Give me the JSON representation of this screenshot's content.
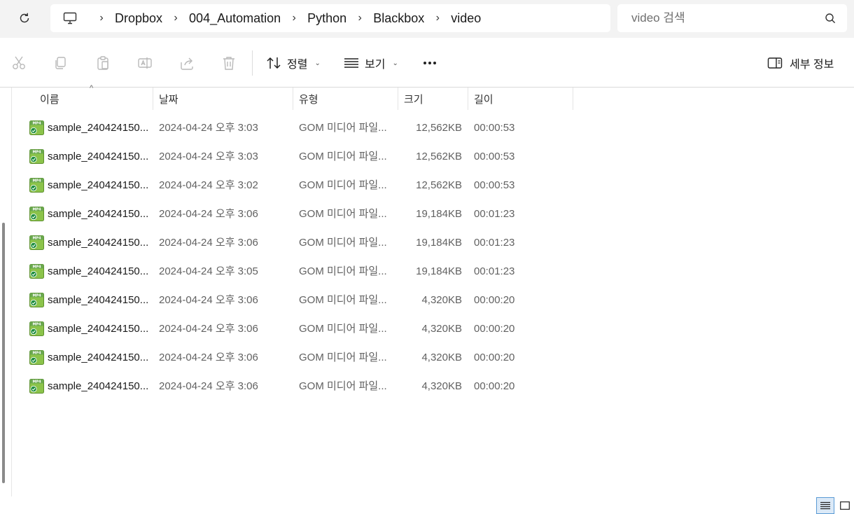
{
  "breadcrumb": {
    "items": [
      "Dropbox",
      "004_Automation",
      "Python",
      "Blackbox",
      "video"
    ]
  },
  "search": {
    "placeholder": "video 검색"
  },
  "toolbar": {
    "sort_label": "정렬",
    "view_label": "보기",
    "details_label": "세부 정보"
  },
  "columns": {
    "name": "이름",
    "date": "날짜",
    "type": "유형",
    "size": "크기",
    "length": "길이"
  },
  "files": [
    {
      "name": "sample_240424150...",
      "date": "2024-04-24 오후 3:03",
      "type": "GOM 미디어 파일...",
      "size": "12,562KB",
      "length": "00:00:53"
    },
    {
      "name": "sample_240424150...",
      "date": "2024-04-24 오후 3:03",
      "type": "GOM 미디어 파일...",
      "size": "12,562KB",
      "length": "00:00:53"
    },
    {
      "name": "sample_240424150...",
      "date": "2024-04-24 오후 3:02",
      "type": "GOM 미디어 파일...",
      "size": "12,562KB",
      "length": "00:00:53"
    },
    {
      "name": "sample_240424150...",
      "date": "2024-04-24 오후 3:06",
      "type": "GOM 미디어 파일...",
      "size": "19,184KB",
      "length": "00:01:23"
    },
    {
      "name": "sample_240424150...",
      "date": "2024-04-24 오후 3:06",
      "type": "GOM 미디어 파일...",
      "size": "19,184KB",
      "length": "00:01:23"
    },
    {
      "name": "sample_240424150...",
      "date": "2024-04-24 오후 3:05",
      "type": "GOM 미디어 파일...",
      "size": "19,184KB",
      "length": "00:01:23"
    },
    {
      "name": "sample_240424150...",
      "date": "2024-04-24 오후 3:06",
      "type": "GOM 미디어 파일...",
      "size": "4,320KB",
      "length": "00:00:20"
    },
    {
      "name": "sample_240424150...",
      "date": "2024-04-24 오후 3:06",
      "type": "GOM 미디어 파일...",
      "size": "4,320KB",
      "length": "00:00:20"
    },
    {
      "name": "sample_240424150...",
      "date": "2024-04-24 오후 3:06",
      "type": "GOM 미디어 파일...",
      "size": "4,320KB",
      "length": "00:00:20"
    },
    {
      "name": "sample_240424150...",
      "date": "2024-04-24 오후 3:06",
      "type": "GOM 미디어 파일...",
      "size": "4,320KB",
      "length": "00:00:20"
    }
  ],
  "icons": {
    "file_icon": "mp4-video-icon",
    "file_icon_label": "MP4",
    "accent": "#5b9bd5",
    "file_icon_green": "#6aa84f"
  }
}
